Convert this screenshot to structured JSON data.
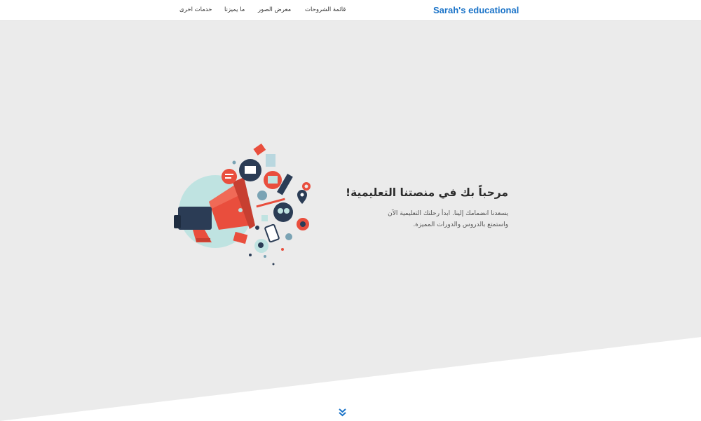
{
  "brand": "Sarah's educational",
  "nav": {
    "items": [
      {
        "label": "قائمة الشروحات"
      },
      {
        "label": "معرض الصور"
      },
      {
        "label": "ما يميزنا"
      },
      {
        "label": "خدمات اخرى"
      }
    ]
  },
  "hero": {
    "title": "مرحباً بك في منصتنا التعليمية!",
    "subtitle_line1": "يسعدنا انضمامك إلينا. ابدأ رحلتك التعليمية الآن",
    "subtitle_line2": "واستمتع بالدروس والدورات المميزة."
  },
  "icons": {
    "illustration": "megaphone-social-media-illustration",
    "scroll": "double-chevron-down-icon"
  },
  "colors": {
    "brand": "#1a73c8",
    "hero_bg": "#ebebeb",
    "megaphone_red": "#e94e3d",
    "megaphone_navy": "#2b3c55",
    "teal_light": "#bfe3e1"
  }
}
